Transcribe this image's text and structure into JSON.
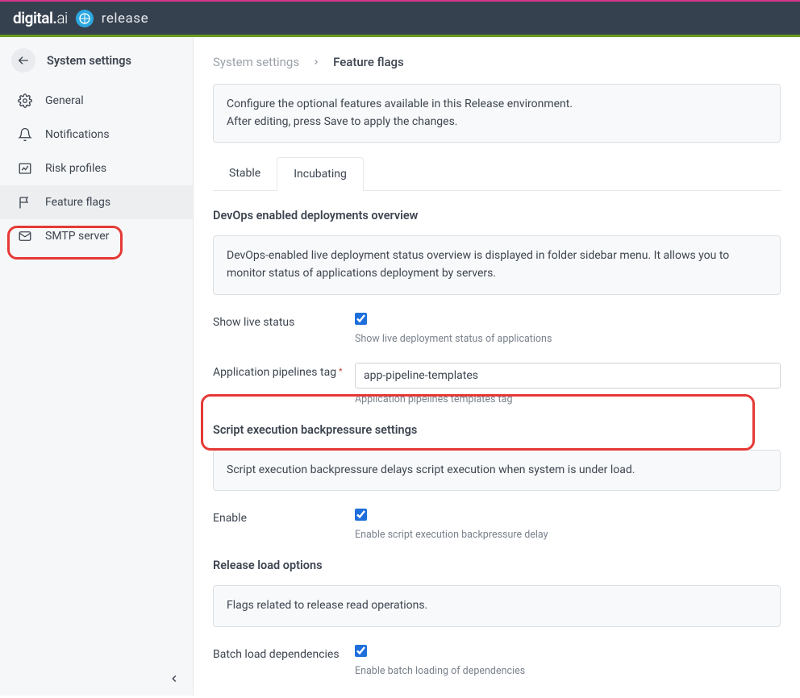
{
  "topbar": {
    "brand_primary": "digital",
    "brand_dot": ".",
    "brand_suffix": "ai",
    "product": "release"
  },
  "sidebar": {
    "title": "System settings",
    "items": [
      {
        "label": "General"
      },
      {
        "label": "Notifications"
      },
      {
        "label": "Risk profiles"
      },
      {
        "label": "Feature flags"
      },
      {
        "label": "SMTP server"
      }
    ]
  },
  "breadcrumb": {
    "parent": "System settings",
    "current": "Feature flags"
  },
  "intro": {
    "line1": "Configure the optional features available in this Release environment.",
    "line2": "After editing, press Save to apply the changes."
  },
  "tabs": {
    "stable": "Stable",
    "incubating": "Incubating"
  },
  "sections": {
    "devops": {
      "title": "DevOps enabled deployments overview",
      "info": "DevOps-enabled live deployment status overview is displayed in folder sidebar menu. It allows you to monitor status of applications deployment by servers.",
      "show_live_status_label": "Show live status",
      "show_live_status_checked": true,
      "show_live_status_help": "Show live deployment status of applications",
      "app_pipelines_label": "Application pipelines tag",
      "app_pipelines_value": "app-pipeline-templates",
      "app_pipelines_help": "Application pipelines templates tag"
    },
    "backpressure": {
      "title": "Script execution backpressure settings",
      "info": "Script execution backpressure delays script execution when system is under load.",
      "enable_label": "Enable",
      "enable_checked": true,
      "enable_help": "Enable script execution backpressure delay"
    },
    "release_load": {
      "title": "Release load options",
      "info": "Flags related to release read operations.",
      "batch_label": "Batch load dependencies",
      "batch_checked": true,
      "batch_help": "Enable batch loading of dependencies"
    }
  }
}
